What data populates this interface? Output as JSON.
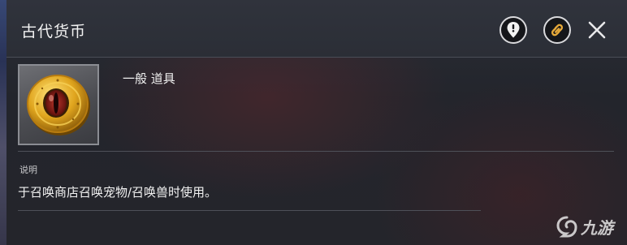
{
  "window": {
    "title": "古代货币"
  },
  "header_actions": {
    "locate_icon": "map-pin-alert-icon",
    "link_icon": "chain-link-icon",
    "close_icon": "close-x-icon"
  },
  "item": {
    "image_name": "ancient-coin-image",
    "category": "一般 道具"
  },
  "description": {
    "label": "说明",
    "text": "于召唤商店召唤宠物/召唤兽时使用。"
  },
  "watermark": {
    "text": "九游"
  },
  "colors": {
    "header_bg": "#2b2e36",
    "panel_bg": "#24252b",
    "divider": "#4e5058",
    "coin_gold": "#d9a21f",
    "coin_eye": "#7a1a12"
  }
}
